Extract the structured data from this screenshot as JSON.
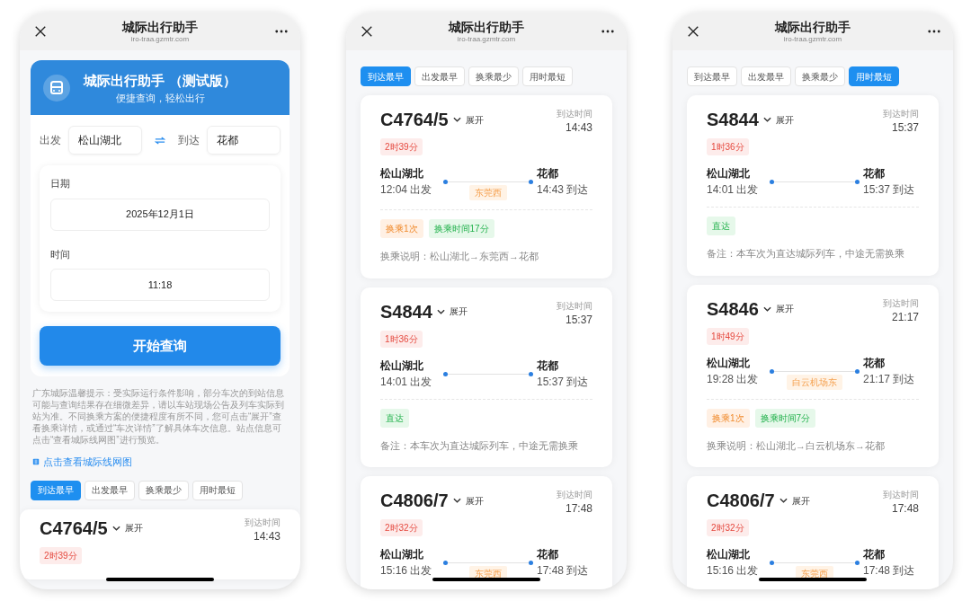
{
  "phones": [
    {
      "kind": "search",
      "header": {
        "title": "城际出行助手",
        "url": "iro-traa.gzmtr.com"
      },
      "banner": {
        "title": "城际出行助手 （测试版）",
        "subtitle": "便捷查询，轻松出行"
      },
      "from": {
        "label": "出发",
        "value": "松山湖北"
      },
      "to": {
        "label": "到达",
        "value": "花都"
      },
      "date": {
        "label": "日期",
        "value": "2025年12月1日"
      },
      "time": {
        "label": "时间",
        "value": "11:18"
      },
      "search_button": "开始查询",
      "notice": "广东城际温馨提示：受实际运行条件影响，部分车次的到站信息可能与查询结果存在细微差异，请以车站现场公告及列车实际到站为准。不同换乘方案的便捷程度有所不同，您可点击“展开”查看换乘详情，或通过“车次详情”了解具体车次信息。站点信息可点击“查看城际线网图”进行预览。",
      "map_link": "点击查看城际线网图",
      "sort_tabs": [
        {
          "label": "到达最早",
          "selected": true
        },
        {
          "label": "出发最早",
          "selected": false
        },
        {
          "label": "换乘最少",
          "selected": false
        },
        {
          "label": "用时最短",
          "selected": false
        }
      ],
      "trips": [
        {
          "train": "C4764/5",
          "expand": "展开",
          "arrival_label": "到达时间",
          "arrival_time": "14:43",
          "duration": "2时39分"
        }
      ]
    },
    {
      "kind": "results",
      "header": {
        "title": "城际出行助手",
        "url": "iro-traa.gzmtr.com"
      },
      "sort_tabs": [
        {
          "label": "到达最早",
          "selected": true
        },
        {
          "label": "出发最早",
          "selected": false
        },
        {
          "label": "换乘最少",
          "selected": false
        },
        {
          "label": "用时最短",
          "selected": false
        }
      ],
      "trips": [
        {
          "train": "C4764/5",
          "expand": "展开",
          "arrival_label": "到达时间",
          "arrival_time": "14:43",
          "duration": "2时39分",
          "from_station": "松山湖北",
          "depart": "12:04 出发",
          "to_station": "花都",
          "arrive": "14:43 到达",
          "via": "东莞西",
          "tags": [
            {
              "text": "换乘1次",
              "kind": "transfer"
            },
            {
              "text": "换乘时间17分",
              "kind": "wait"
            }
          ],
          "note": "换乘说明：松山湖北→东莞西→花都"
        },
        {
          "train": "S4844",
          "expand": "展开",
          "arrival_label": "到达时间",
          "arrival_time": "15:37",
          "duration": "1时36分",
          "from_station": "松山湖北",
          "depart": "14:01 出发",
          "to_station": "花都",
          "arrive": "15:37 到达",
          "tags": [
            {
              "text": "直达",
              "kind": "direct"
            }
          ],
          "note": "备注：本车次为直达城际列车，中途无需换乘"
        },
        {
          "train": "C4806/7",
          "expand": "展开",
          "arrival_label": "到达时间",
          "arrival_time": "17:48",
          "duration": "2时32分",
          "from_station": "松山湖北",
          "depart": "15:16 出发",
          "to_station": "花都",
          "arrive": "17:48 到达",
          "via": "东莞西"
        }
      ]
    },
    {
      "kind": "results",
      "header": {
        "title": "城际出行助手",
        "url": "iro-traa.gzmtr.com"
      },
      "sort_tabs": [
        {
          "label": "到达最早",
          "selected": false
        },
        {
          "label": "出发最早",
          "selected": false
        },
        {
          "label": "换乘最少",
          "selected": false
        },
        {
          "label": "用时最短",
          "selected": true
        }
      ],
      "trips": [
        {
          "train": "S4844",
          "expand": "展开",
          "arrival_label": "到达时间",
          "arrival_time": "15:37",
          "duration": "1时36分",
          "from_station": "松山湖北",
          "depart": "14:01 出发",
          "to_station": "花都",
          "arrive": "15:37 到达",
          "tags": [
            {
              "text": "直达",
              "kind": "direct"
            }
          ],
          "note": "备注：本车次为直达城际列车，中途无需换乘"
        },
        {
          "train": "S4846",
          "expand": "展开",
          "arrival_label": "到达时间",
          "arrival_time": "21:17",
          "duration": "1时49分",
          "from_station": "松山湖北",
          "depart": "19:28 出发",
          "to_station": "花都",
          "arrive": "21:17 到达",
          "via": "白云机场东",
          "tags": [
            {
              "text": "换乘1次",
              "kind": "transfer"
            },
            {
              "text": "换乘时间7分",
              "kind": "wait"
            }
          ],
          "note": "换乘说明：松山湖北→白云机场东→花都"
        },
        {
          "train": "C4806/7",
          "expand": "展开",
          "arrival_label": "到达时间",
          "arrival_time": "17:48",
          "duration": "2时32分",
          "from_station": "松山湖北",
          "depart": "15:16 出发",
          "to_station": "花都",
          "arrive": "17:48 到达",
          "via": "东莞西"
        }
      ]
    }
  ]
}
